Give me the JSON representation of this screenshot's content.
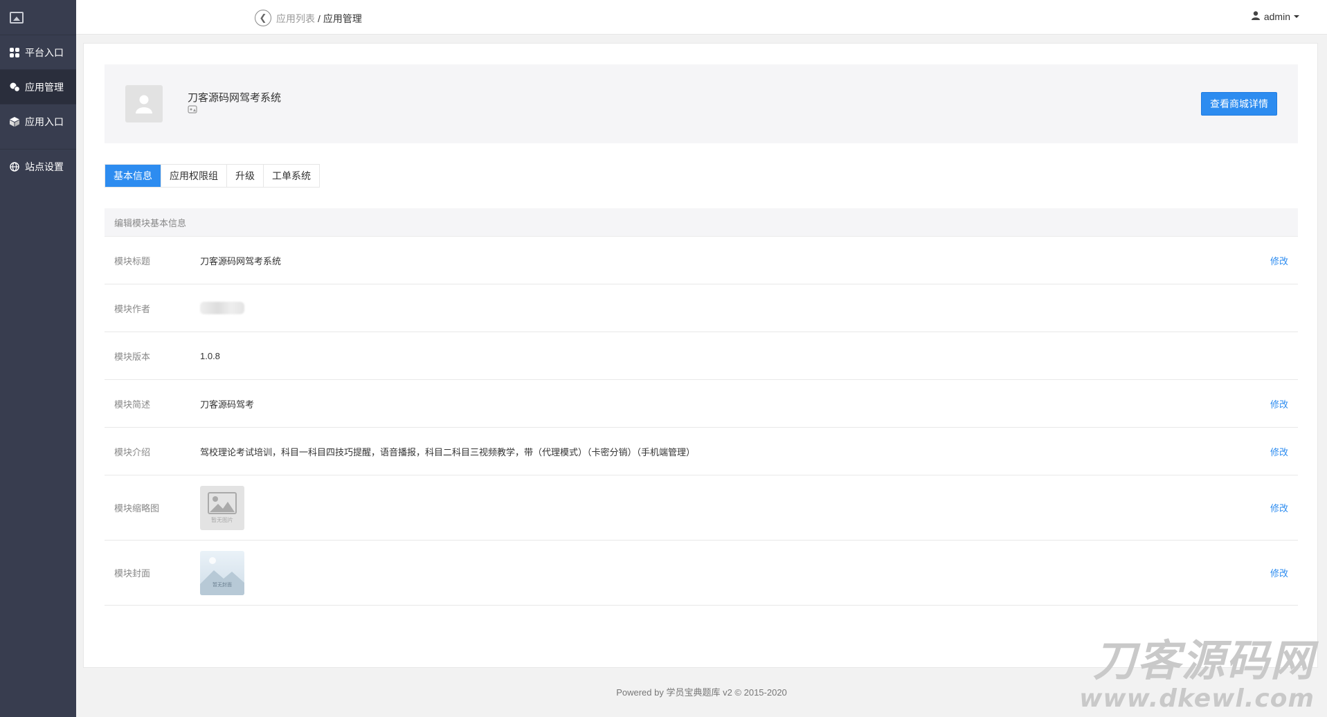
{
  "sidebar": {
    "logo_icon": "image-icon",
    "items": [
      {
        "label": "平台入口",
        "icon": "grid-icon"
      },
      {
        "label": "应用管理",
        "icon": "cubes-icon"
      },
      {
        "label": "应用入口",
        "icon": "cube-icon"
      },
      {
        "label": "站点设置",
        "icon": "globe-icon"
      }
    ]
  },
  "topbar": {
    "breadcrumb": {
      "parent": "应用列表",
      "separator": "/",
      "current": "应用管理"
    },
    "user": "admin"
  },
  "app": {
    "name": "刀客源码网驾考系统",
    "store_button": "查看商城详情"
  },
  "tabs": [
    "基本信息",
    "应用权限组",
    "升级",
    "工单系统"
  ],
  "section": {
    "title": "编辑模块基本信息",
    "edit_label": "修改",
    "rows": {
      "title": {
        "label": "模块标题",
        "value": "刀客源码网驾考系统"
      },
      "author": {
        "label": "模块作者"
      },
      "version": {
        "label": "模块版本",
        "value": "1.0.8"
      },
      "summary": {
        "label": "模块简述",
        "value": "刀客源码驾考"
      },
      "intro": {
        "label": "模块介绍",
        "value": "驾校理论考试培训，科目一科目四技巧提醒，语音播报，科目二科目三视频教学，带（代理模式）（卡密分销）（手机端管理）"
      },
      "thumb": {
        "label": "模块缩略图",
        "placeholder": "暂无图片"
      },
      "cover": {
        "label": "模块封面",
        "placeholder": "暂无封面"
      }
    }
  },
  "footer": "Powered by 学员宝典题库 v2 © 2015-2020",
  "watermark": {
    "line1": "刀客源码网",
    "line2": "www.dkewl.com"
  }
}
